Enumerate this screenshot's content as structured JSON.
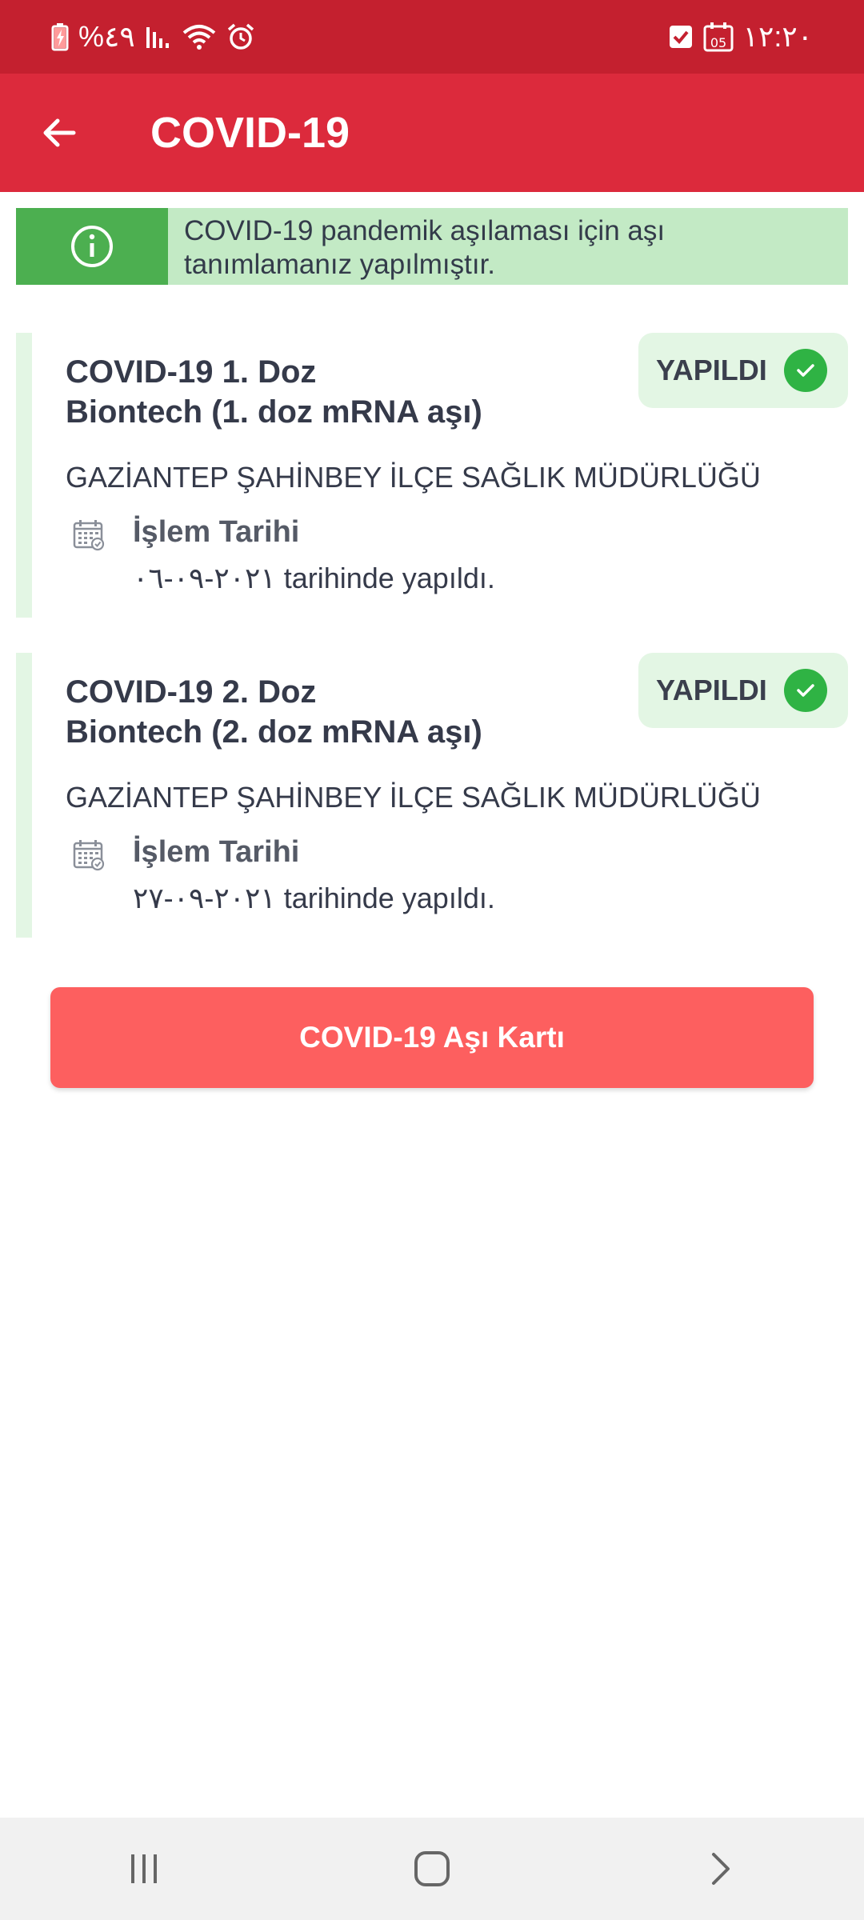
{
  "status_bar": {
    "battery": "%٤٩",
    "time": "١٢:٢٠",
    "calendar_day": "05"
  },
  "app_bar": {
    "title": "COVID-19",
    "back_icon": "arrow-left-icon"
  },
  "info_banner": {
    "icon": "info-icon",
    "text": "COVID-19 pandemik aşılaması için aşı tanımlamanız yapılmıştır."
  },
  "vaccinations": [
    {
      "title_line1": "COVID-19 1. Doz",
      "title_line2": "Biontech (1. doz mRNA aşı)",
      "status": "YAPILDI",
      "organization": "GAZİANTEP ŞAHİNBEY İLÇE SAĞLIK MÜDÜRLÜĞÜ",
      "date_label": "İşlem Tarihi",
      "date_text": "٢٠٢١-٠٩-٠٦ tarihinde yapıldı."
    },
    {
      "title_line1": "COVID-19 2. Doz",
      "title_line2": "Biontech (2. doz mRNA aşı)",
      "status": "YAPILDI",
      "organization": "GAZİANTEP ŞAHİNBEY İLÇE SAĞLIK MÜDÜRLÜĞÜ",
      "date_label": "İşlem Tarihi",
      "date_text": "٢٠٢١-٠٩-٢٧ tarihinde yapıldı."
    }
  ],
  "actions": {
    "vaccine_card_label": "COVID-19 Aşı Kartı"
  },
  "colors": {
    "status_bar": "#c4202f",
    "app_bar": "#dc2a3c",
    "info_icon_bg": "#4caf50",
    "info_bg": "#c3eac5",
    "chip_bg": "#e3f6e4",
    "check": "#2fb344",
    "primary_button": "#fd5f5f"
  }
}
